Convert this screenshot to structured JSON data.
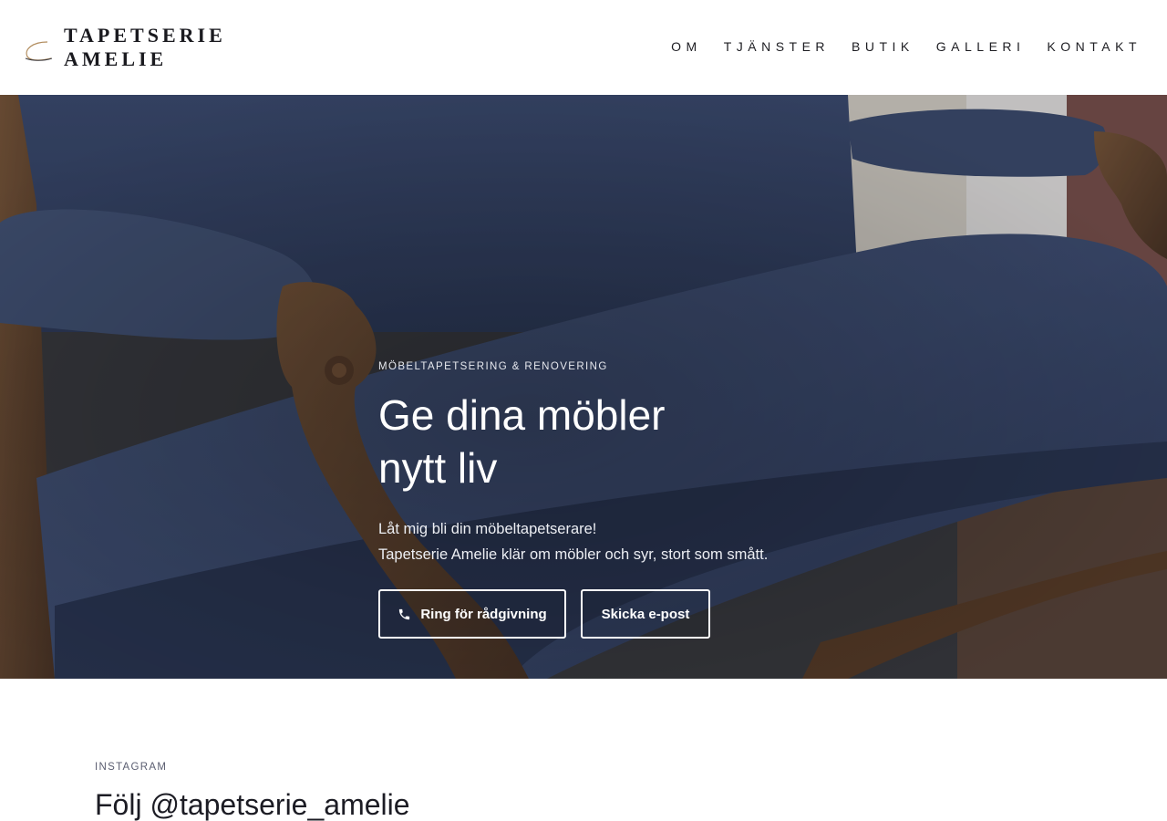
{
  "header": {
    "logo_line1": "TAPETSERIE",
    "logo_line2": "AMELIE",
    "logo_icon": "swoosh-icon",
    "nav": [
      {
        "label": "OM"
      },
      {
        "label": "TJÄNSTER"
      },
      {
        "label": "BUTIK"
      },
      {
        "label": "GALLERI"
      },
      {
        "label": "KONTAKT"
      }
    ]
  },
  "hero": {
    "image": "blue-velvet-sofa-photo",
    "eyebrow": "MÖBELTAPETSERING & RENOVERING",
    "title_line1": "Ge dina möbler",
    "title_line2": "nytt liv",
    "text_line1": "Låt mig bli din möbeltapetserare!",
    "text_line2": "Tapetserie Amelie klär om möbler och syr, stort som smått.",
    "call_button": "Ring för rådgivning",
    "call_icon": "phone-icon",
    "mail_button": "Skicka e-post"
  },
  "instagram": {
    "eyebrow": "INSTAGRAM",
    "title": "Följ @tapetserie_amelie"
  },
  "colors": {
    "velvet": "#3b4a6b",
    "wood": "#6b4a2e",
    "text": "#1d1d22",
    "muted": "#5a5d70"
  }
}
